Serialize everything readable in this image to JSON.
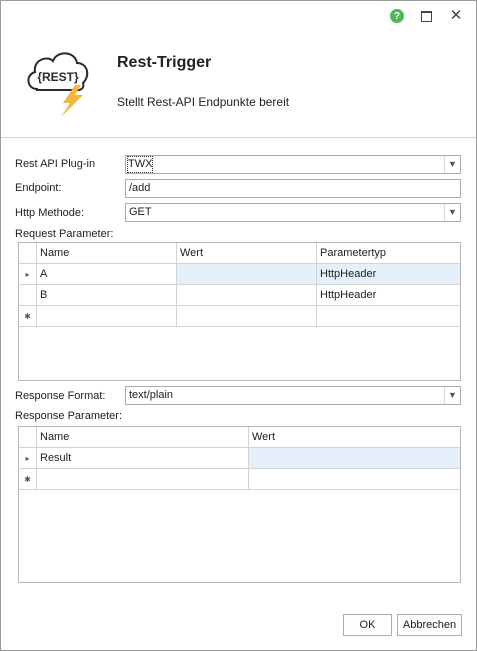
{
  "window": {
    "help_icon": "help-icon",
    "help_glyph": "?",
    "maximize_icon": "maximize-icon",
    "close_icon": "close-icon",
    "close_glyph": "✕",
    "accent": "#53b84f"
  },
  "header": {
    "logo_text": "{REST}",
    "title": "Rest-Trigger",
    "subtitle": "Stellt Rest-API Endpunkte bereit"
  },
  "form": {
    "plugin_label": "Rest API Plug-in",
    "plugin_value": "TWX",
    "endpoint_label": "Endpoint:",
    "endpoint_value": "/add",
    "method_label": "Http Methode:",
    "method_value": "GET",
    "request_label": "Request Parameter:",
    "response_format_label": "Response Format:",
    "response_format_value": "text/plain",
    "response_label": "Response Parameter:"
  },
  "request_grid": {
    "columns": [
      "Name",
      "Wert",
      "Parametertyp"
    ],
    "rows": [
      {
        "name": "A",
        "wert": "",
        "typ": "HttpHeader"
      },
      {
        "name": "B",
        "wert": "",
        "typ": "HttpHeader"
      }
    ],
    "current_row_glyph": "▸",
    "new_row_glyph": "✱"
  },
  "response_grid": {
    "columns": [
      "Name",
      "Wert"
    ],
    "rows": [
      {
        "name": "Result",
        "wert": ""
      }
    ]
  },
  "buttons": {
    "ok": "OK",
    "cancel": "Abbrechen"
  }
}
